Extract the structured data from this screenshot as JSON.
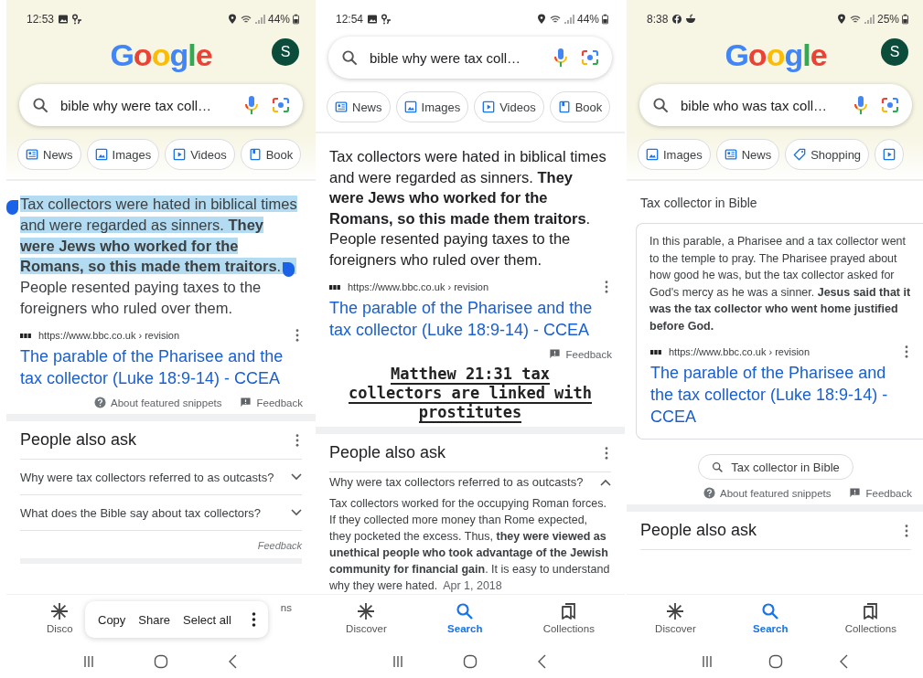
{
  "panels": [
    {
      "status": {
        "time": "12:53",
        "battery": "44%"
      },
      "header": {
        "logo": "Google",
        "avatar": "S"
      },
      "search": {
        "value": "bible why were tax coll…"
      },
      "chips": [
        {
          "label": "News"
        },
        {
          "label": "Images"
        },
        {
          "label": "Videos"
        },
        {
          "label": "Book"
        }
      ],
      "blocks": [
        {
          "kind": "snippet",
          "segments": [
            {
              "text": "Tax collectors were hated in biblical times and were regarded as sinners. **They were Jews who worked for the Romans, so this made them traitors**.",
              "selected": true
            },
            {
              "text": "People resented paying taxes to the foreigners who ruled over them.",
              "selected": false
            }
          ]
        },
        {
          "kind": "source",
          "url": "https://www.bbc.co.uk › revision"
        },
        {
          "kind": "result_link",
          "text": "The parable of the Pharisee and the tax collector (Luke 18:9-14) - CCEA"
        },
        {
          "kind": "footer",
          "about": "About featured snippets",
          "feedback": "Feedback"
        },
        {
          "kind": "separator"
        },
        {
          "kind": "paa",
          "title": "People also ask",
          "questions": [
            {
              "text": "Why were tax collectors referred to as outcasts?",
              "expanded": false
            },
            {
              "text": "What does the Bible say about tax collectors?",
              "expanded": false
            }
          ],
          "feedback": "Feedback"
        }
      ],
      "nav": [
        {
          "label": "Disco",
          "selected": false
        },
        {
          "label": "ns",
          "selected": false
        }
      ],
      "context_menu": {
        "items": [
          "Copy",
          "Share",
          "Select all"
        ]
      }
    },
    {
      "status": {
        "time": "12:54",
        "battery": "44%"
      },
      "search": {
        "value": "bible why were tax coll…"
      },
      "chips": [
        {
          "label": "News"
        },
        {
          "label": "Images"
        },
        {
          "label": "Videos"
        },
        {
          "label": "Book"
        }
      ],
      "blocks": [
        {
          "kind": "snippet",
          "segments": [
            {
              "text": "Tax collectors were hated in biblical times and were regarded as sinners. **They were Jews who worked for the Romans, so this made them traitors**. People resented paying taxes to the foreigners who ruled over them.",
              "selected": false
            }
          ]
        },
        {
          "kind": "source",
          "url": "https://www.bbc.co.uk › revision"
        },
        {
          "kind": "result_link",
          "text": "The parable of the Pharisee and the tax collector (Luke 18:9-14) - CCEA"
        },
        {
          "kind": "footer",
          "feedback": "Feedback"
        },
        {
          "kind": "annotation",
          "lines": [
            "Matthew 21:31 tax",
            "collectors are linked with",
            "prostitutes"
          ]
        },
        {
          "kind": "separator"
        },
        {
          "kind": "paa",
          "title": "People also ask",
          "questions": [
            {
              "text": "Why were tax collectors referred to as outcasts?",
              "expanded": true,
              "answer": "Tax collectors worked for the occupying Roman forces. If they collected more money than Rome expected, they pocketed the excess. Thus, **they were viewed as unethical people who took advantage of the Jewish community for financial gain**. It is easy to understand why they were hated.",
              "date": "Apr 1, 2018"
            }
          ]
        }
      ],
      "nav": [
        {
          "label": "Discover",
          "selected": false
        },
        {
          "label": "Search",
          "selected": true
        },
        {
          "label": "Collections",
          "selected": false
        }
      ]
    },
    {
      "status": {
        "time": "8:38",
        "battery": "25%"
      },
      "header": {
        "logo": "Google",
        "avatar": "S"
      },
      "search": {
        "value": "bible who was tax coll…"
      },
      "chips": [
        {
          "label": "Images"
        },
        {
          "label": "News"
        },
        {
          "label": "Shopping"
        }
      ],
      "blocks": [
        {
          "kind": "heading",
          "text": "Tax collector in Bible"
        },
        {
          "kind": "card",
          "blocks": [
            {
              "kind": "paragraph",
              "text": "In this parable, a Pharisee and a tax collector went to the temple to pray. The Pharisee prayed about how good he was, but the tax collector asked for God's mercy as he was a sinner. **Jesus said that it was the tax collector who went home justified before God.**"
            },
            {
              "kind": "source",
              "url": "https://www.bbc.co.uk › revision"
            },
            {
              "kind": "result_link",
              "text": "The parable of the Pharisee and the tax collector (Luke 18:9-14) - CCEA"
            }
          ]
        },
        {
          "kind": "related_chip",
          "label": "Tax collector in Bible"
        },
        {
          "kind": "footer",
          "about": "About featured snippets",
          "feedback": "Feedback"
        },
        {
          "kind": "separator"
        },
        {
          "kind": "paa",
          "title": "People also ask"
        }
      ],
      "nav": [
        {
          "label": "Discover",
          "selected": false
        },
        {
          "label": "Search",
          "selected": true
        },
        {
          "label": "Collections",
          "selected": false
        }
      ]
    }
  ]
}
